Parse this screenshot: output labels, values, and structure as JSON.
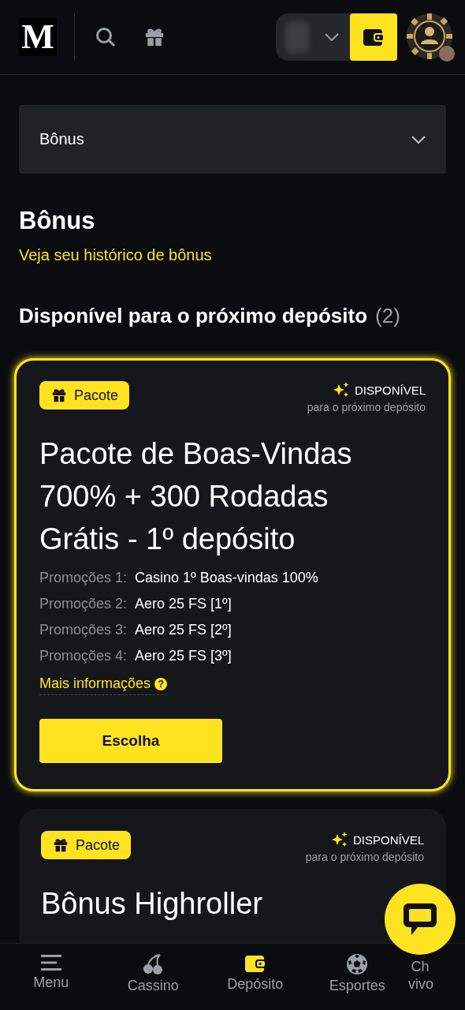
{
  "header": {
    "logo": "M"
  },
  "filter": {
    "value": "Bônus"
  },
  "page_title": "Bônus",
  "history_link": "Veja seu histórico de bônus",
  "section": {
    "title": "Disponível para o próximo depósito",
    "count": "(2)"
  },
  "cards": [
    {
      "highlighted": true,
      "tag": "Pacote",
      "status": "DISPONÍVEL",
      "status_note": "para o próximo depósito",
      "title": "Pacote de Boas-Vindas 700% + 300 Rodadas Grátis - 1º depósito",
      "promotions": [
        {
          "label": "Promoções 1:",
          "value": "Casino 1º Boas-vindas 100%"
        },
        {
          "label": "Promoções 2:",
          "value": "Aero 25 FS [1º]"
        },
        {
          "label": "Promoções 3:",
          "value": "Aero 25 FS [2º]"
        },
        {
          "label": "Promoções 4:",
          "value": "Aero 25 FS [3º]"
        }
      ],
      "more_info": "Mais informações",
      "help": "?",
      "button": "Escolha"
    },
    {
      "highlighted": false,
      "tag": "Pacote",
      "status": "DISPONÍVEL",
      "status_note": "para o próximo depósito",
      "title": "Bônus Highroller"
    }
  ],
  "bottom_nav": [
    {
      "kind": "menu",
      "label": "Menu",
      "selected": false
    },
    {
      "kind": "casino",
      "label": "Cassino",
      "selected": false
    },
    {
      "kind": "deposit",
      "label": "Depósito",
      "selected": true
    },
    {
      "kind": "sports",
      "label": "Esportes",
      "selected": false
    },
    {
      "kind": "chat",
      "label": "Ch vivo",
      "selected": false
    }
  ]
}
